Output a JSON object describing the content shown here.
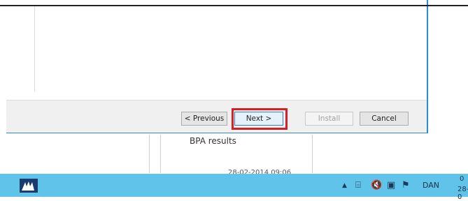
{
  "wizard": {
    "buttons": {
      "previous": "< Previous",
      "next": "Next >",
      "install": "Install",
      "cancel": "Cancel"
    },
    "highlighted_button": "next",
    "highlight_color": "#d61f26"
  },
  "background": {
    "bpa_title": "BPA results",
    "bpa_date": "28-02-2014 09:06"
  },
  "taskbar": {
    "start_icon": "windows-logo-icon",
    "tray_icons": [
      "show-hidden-icons-arrow",
      "network-icon",
      "volume-muted-icon",
      "action-center-icon",
      "flag-alert-icon"
    ],
    "language": "DAN",
    "clock_time": "0",
    "clock_date": "28-0",
    "color": "#60c4ea"
  }
}
